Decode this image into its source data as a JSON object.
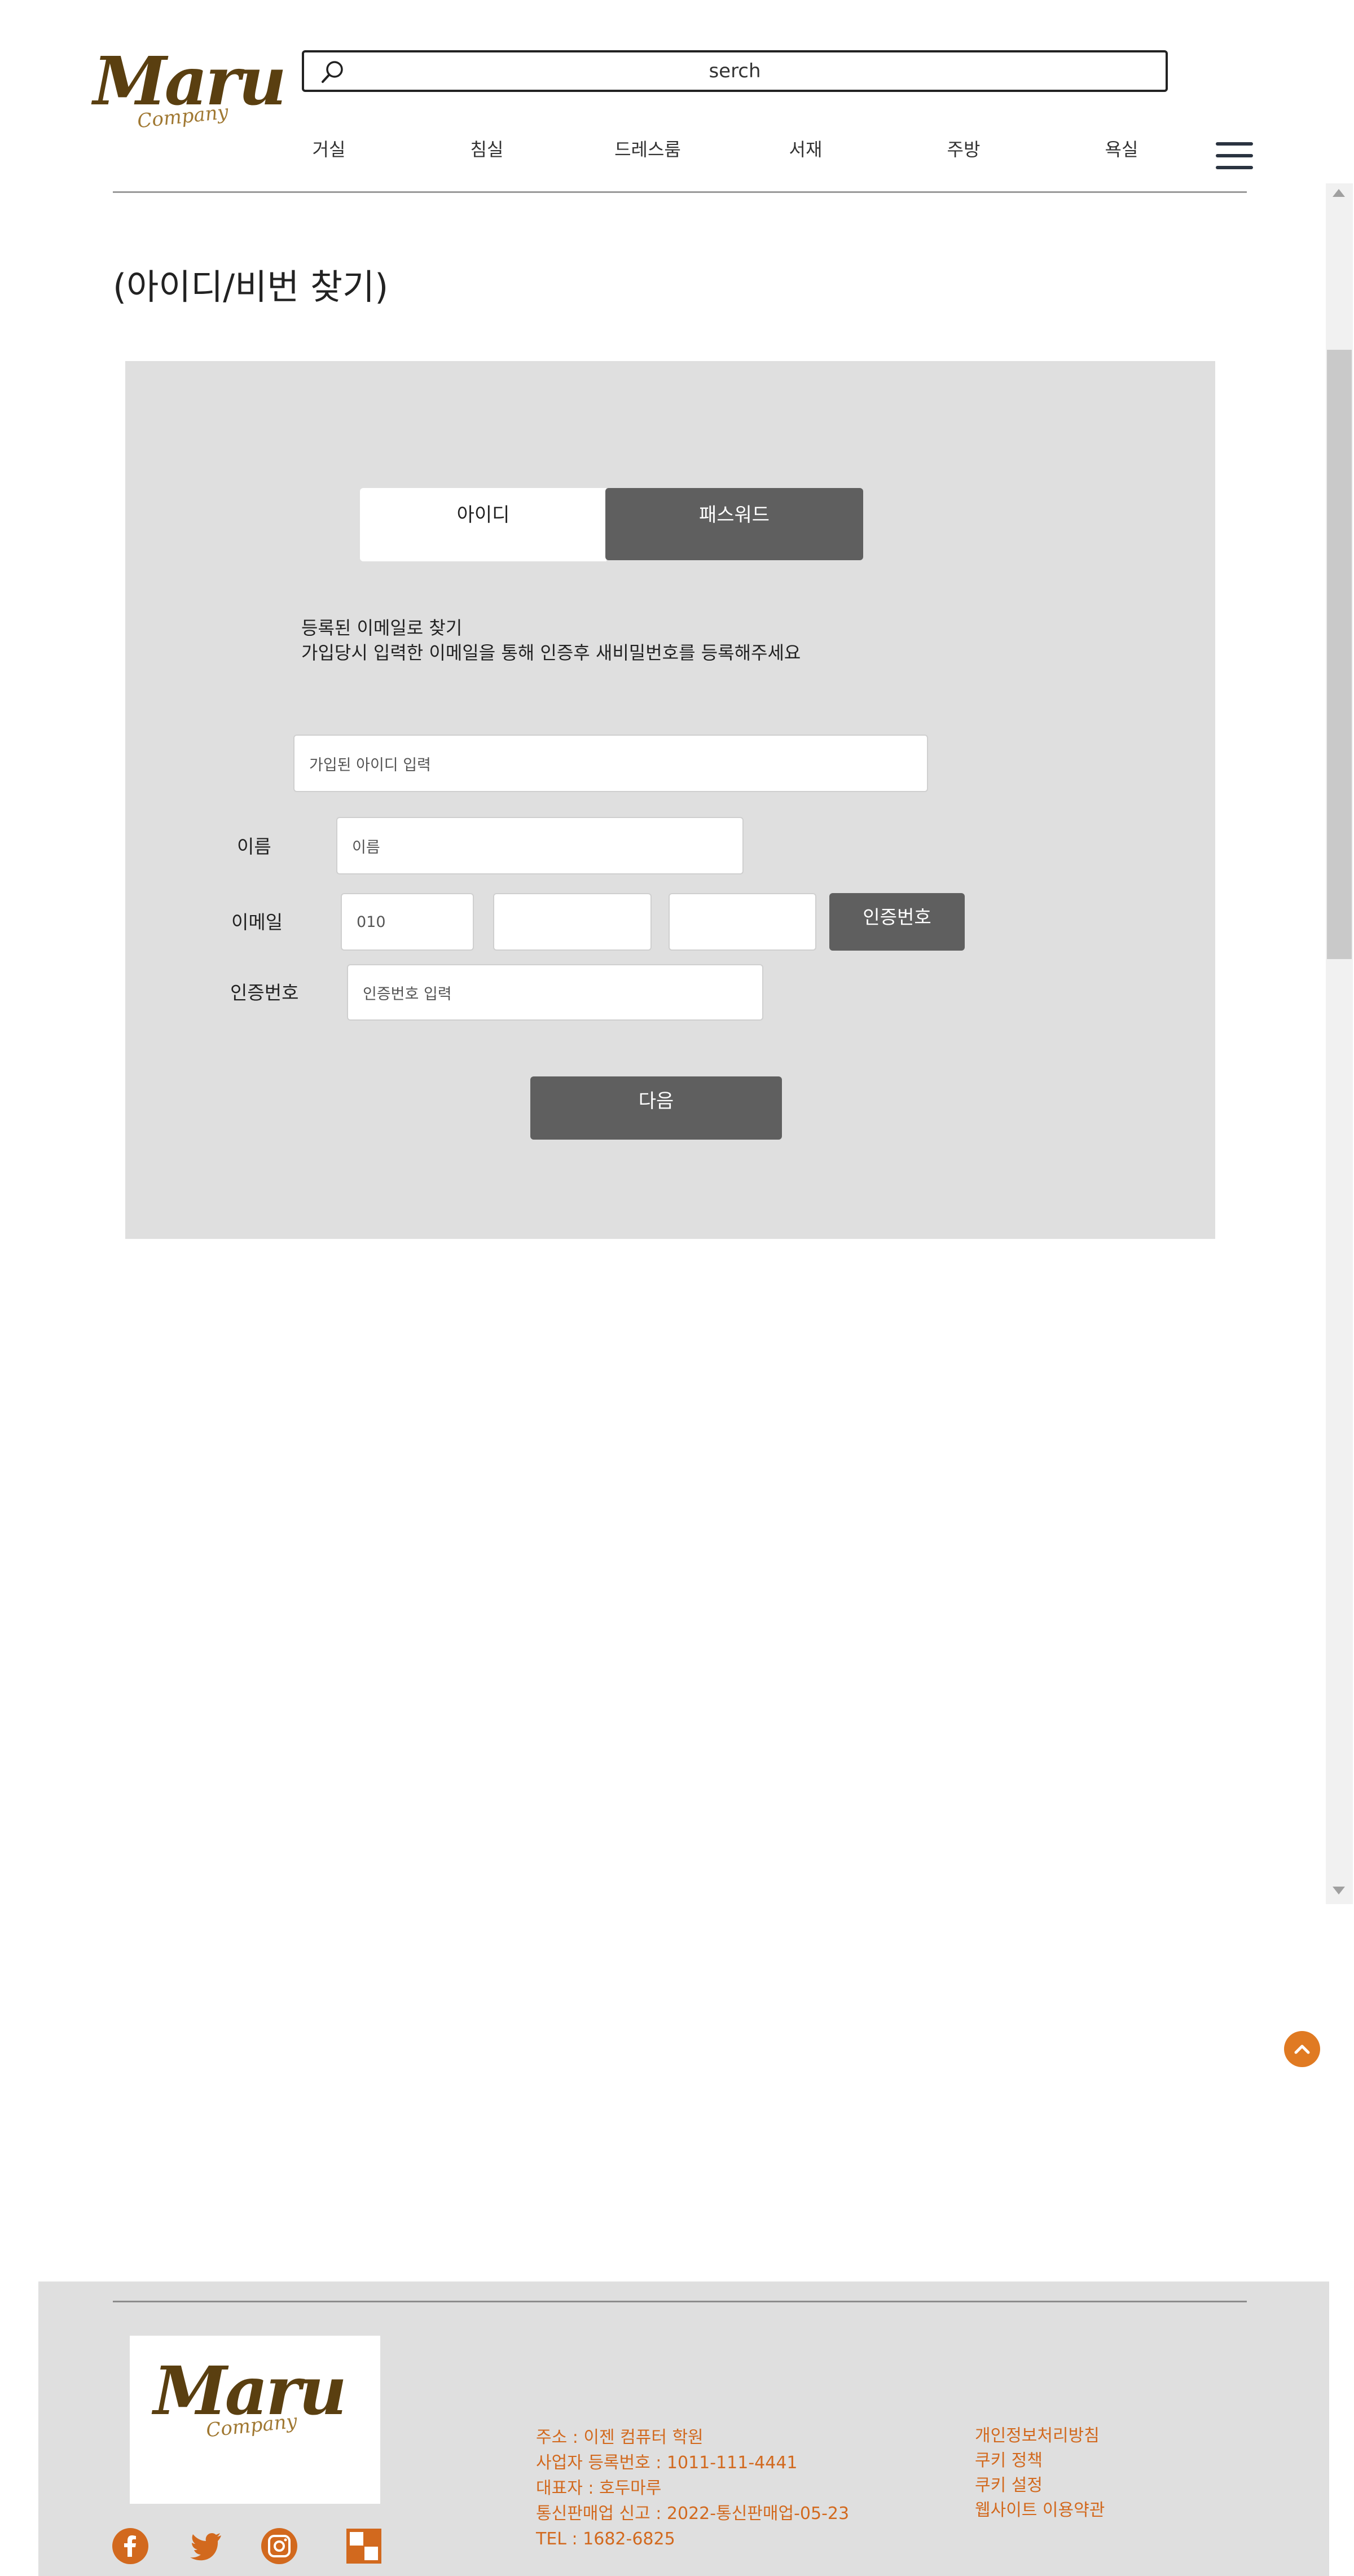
{
  "header": {
    "logo": {
      "script": "Maru",
      "sub": "Company"
    },
    "search": {
      "placeholder": "serch"
    },
    "nav": [
      "거실",
      "침실",
      "드레스룸",
      "서재",
      "주방",
      "욕실"
    ]
  },
  "page_title": "(아이디/비번 찾기)",
  "form": {
    "tabs": {
      "id": "아이디",
      "password": "패스워드"
    },
    "desc_line1": "등록된 이메일로 찾기",
    "desc_line2": "가입당시 입력한 이메일을 통해 인증후 새비밀번호를 등록해주세요",
    "id_input_placeholder": "가입된 아이디 입력",
    "name_label": "이름",
    "name_placeholder": "이름",
    "email_label": "이메일",
    "email_part1": "010",
    "email_part2": "",
    "email_part3": "",
    "send_code_button": "인증번호",
    "code_label": "인증번호",
    "code_placeholder": "인증번호 입력",
    "next_button": "다음"
  },
  "footer": {
    "logo": {
      "script": "Maru",
      "sub": "Company"
    },
    "info": [
      "주소 : 이젠 컴퓨터 학원",
      "사업자 등록번호 : 1011-111-4441",
      "대표자 : 호두마루",
      "통신판매업 신고 : 2022-통신판매업-05-23",
      "TEL : 1682-6825"
    ],
    "links": [
      "개인정보처리방침",
      "쿠키 정책",
      "쿠키 설정",
      "웹사이트 이용약관"
    ],
    "social_icons": [
      "facebook-icon",
      "twitter-icon",
      "instagram-icon",
      "checker-icon"
    ],
    "accent_color": "#d2691e"
  }
}
